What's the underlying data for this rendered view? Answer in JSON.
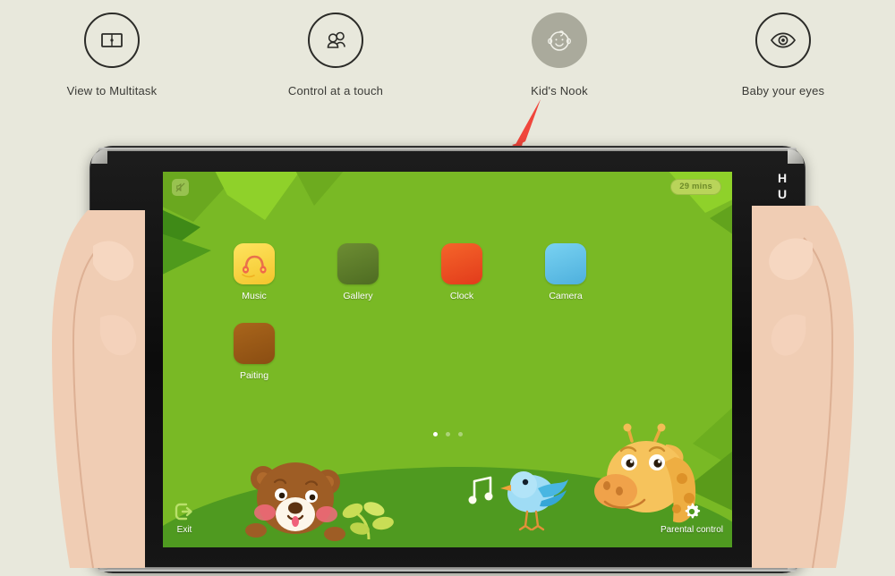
{
  "features": [
    {
      "label": "View to Multitask",
      "icon": "multitask-split-screen-icon",
      "active": false
    },
    {
      "label": "Control at a touch",
      "icon": "multi-user-icon",
      "active": false
    },
    {
      "label": "Kid's Nook",
      "icon": "baby-face-icon",
      "active": true
    },
    {
      "label": "Baby your eyes",
      "icon": "eye-icon",
      "active": false
    }
  ],
  "annotation": {
    "name": "red-arrow-pointer",
    "color": "#f0463c"
  },
  "device": {
    "brand": "HUAWEI",
    "home_button": "home-button",
    "front_camera": "front-camera"
  },
  "screen": {
    "status": {
      "mute_icon": "sound-off-icon",
      "time_remaining": "29 mins"
    },
    "apps": [
      {
        "label": "Music",
        "icon": "music-headphones-icon",
        "color": "#f5d13c"
      },
      {
        "label": "Gallery",
        "icon": "gallery-photo-icon",
        "color": "#5d7c2a"
      },
      {
        "label": "Clock",
        "icon": "clock-icon",
        "color": "#ef4a23"
      },
      {
        "label": "Camera",
        "icon": "camera-icon",
        "color": "#5fc3ea"
      },
      {
        "label": "Paiting",
        "icon": "painting-palette-icon",
        "color": "#9a5a18"
      }
    ],
    "pages": {
      "count": 3,
      "active": 1
    },
    "bottom_bar": {
      "exit_label": "Exit",
      "exit_icon": "exit-arrow-icon",
      "parental_label": "Parental control",
      "parental_icon": "gear-icon"
    },
    "characters": [
      {
        "name": "bear-character"
      },
      {
        "name": "bird-character"
      },
      {
        "name": "giraffe-character"
      },
      {
        "name": "clover-plant"
      }
    ],
    "colors": {
      "background_green": "#79b925",
      "ground_green": "#4f9a20",
      "badge_green": "#b9d45a"
    }
  }
}
